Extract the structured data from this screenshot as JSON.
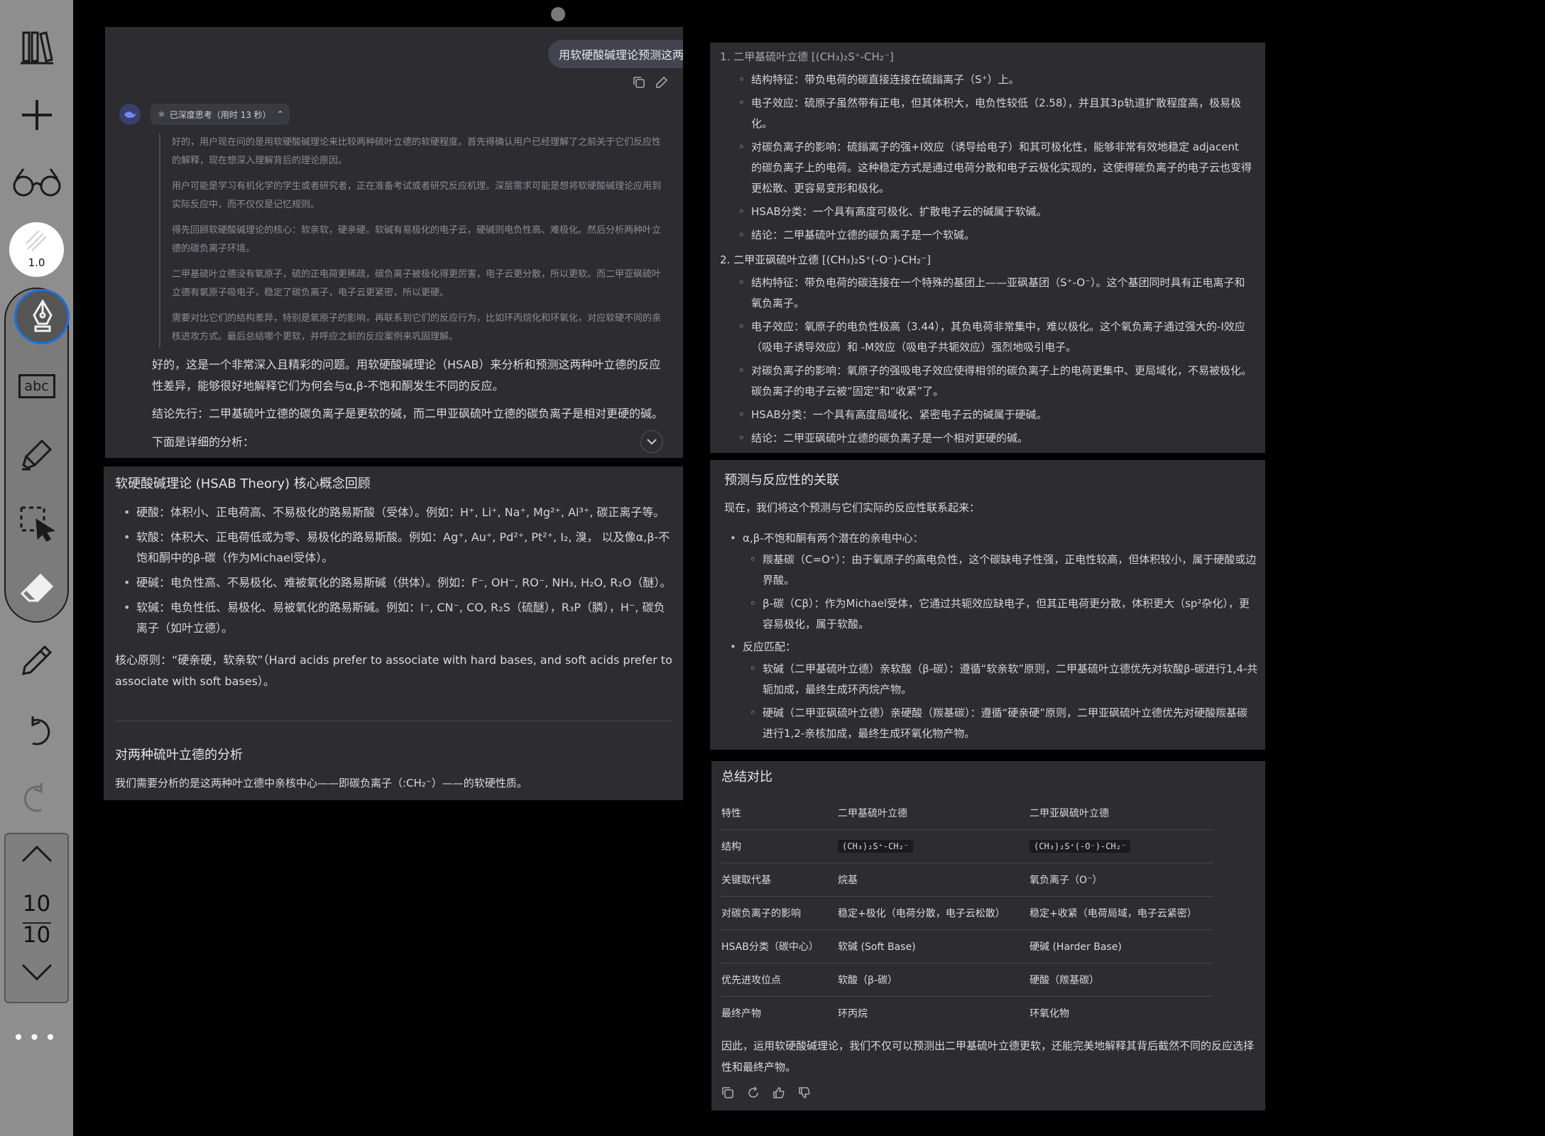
{
  "toolbar": {
    "brush_size": "1.0",
    "text_tool_label": "abc",
    "page_current": "10",
    "page_total": "10"
  },
  "chat": {
    "user_question": "用软硬酸碱理论预测这两种叶立德谁更软",
    "thinking_label": "已深度思考（用时 13 秒）",
    "thinking_paragraphs": [
      "好的，用户现在问的是用软硬酸碱理论来比较两种硫叶立德的软硬程度。首先得确认用户已经理解了之前关于它们反应性的解释，现在想深入理解背后的理论原因。",
      "用户可能是学习有机化学的学生或者研究者，正在准备考试或者研究反应机理。深层需求可能是想将软硬酸碱理论应用到实际反应中，而不仅仅是记忆规则。",
      "得先回顾软硬酸碱理论的核心：软亲软，硬亲硬。软碱有易极化的电子云，硬碱则电负性高、难极化。然后分析两种叶立德的碳负离子环境。",
      "二甲基硫叶立德没有氧原子，硫的正电荷更稀疏，碳负离子被极化得更厉害，电子云更分散，所以更软。而二甲亚砜硫叶立德有氧原子吸电子，稳定了碳负离子，电子云更紧密，所以更硬。",
      "需要对比它们的结构差异，特别是氧原子的影响，再联系到它们的反应行为，比如环丙烷化和环氧化，对应软硬不同的亲核进攻方式。最后总结哪个更软，并呼应之前的反应案例来巩固理解。"
    ],
    "answer_intro": "好的，这是一个非常深入且精彩的问题。用软硬酸碱理论（HSAB）来分析和预测这两种叶立德的反应性差异，能够很好地解释它们为何会与α,β-不饱和酮发生不同的反应。",
    "answer_conclusion": "结论先行：二甲基硫叶立德的碳负离子是更软的碱，而二甲亚砜硫叶立德的碳负离子是相对更硬的碱。",
    "answer_next": "下面是详细的分析："
  },
  "hsab": {
    "title": "软硬酸碱理论 (HSAB Theory) 核心概念回顾",
    "items": [
      "硬酸：体积小、正电荷高、不易极化的路易斯酸（受体）。例如：H⁺, Li⁺, Na⁺, Mg²⁺, Al³⁺, 碳正离子等。",
      "软酸：体积大、正电荷低或为零、易极化的路易斯酸。例如：Ag⁺, Au⁺, Pd²⁺, Pt²⁺, I₂, 溴， 以及像α,β-不饱和酮中的β-碳（作为Michael受体）。",
      "硬碱：电负性高、不易极化、难被氧化的路易斯碱（供体）。例如：F⁻, OH⁻, RO⁻, NH₃, H₂O, R₂O（醚）。",
      "软碱：电负性低、易极化、易被氧化的路易斯碱。例如：I⁻, CN⁻, CO, R₂S（硫醚），R₃P（膦），H⁻, 碳负离子（如叶立德）。"
    ],
    "principle": "核心原则：“硬亲硬，软亲软”（Hard acids prefer to associate with hard bases, and soft acids prefer to associate with soft bases）。",
    "analysis_title": "对两种硫叶立德的分析",
    "analysis_text": "我们需要分析的是这两种叶立德中亲核中心——即碳负离子（:CH₂⁻）——的软硬性质。"
  },
  "ylides": [
    {
      "heading": "二甲基硫叶立德 [(CH₃)₂S⁺-CH₂⁻]",
      "points": [
        "结构特征：带负电荷的碳直接连接在硫鎓离子（S⁺）上。",
        "电子效应：硫原子虽然带有正电，但其体积大，电负性较低（2.58），并且其3p轨道扩散程度高，极易极化。",
        "对碳负离子的影响：硫鎓离子的强+I效应（诱导给电子）和其可极化性，能够非常有效地稳定 adjacent 的碳负离子上的电荷。这种稳定方式是通过电荷分散和电子云极化实现的，这使得碳负离子的电子云也变得更松散、更容易变形和极化。",
        "HSAB分类：一个具有高度可极化、扩散电子云的碱属于软碱。",
        "结论：二甲基硫叶立德的碳负离子是一个软碱。"
      ]
    },
    {
      "heading": "二甲亚砜硫叶立德 [(CH₃)₂S⁺(-O⁻)-CH₂⁻]",
      "points": [
        "结构特征：带负电荷的碳连接在一个特殊的基团上——亚砜基团（S⁺-O⁻）。这个基团同时具有正电离子和氧负离子。",
        "电子效应：氧原子的电负性极高（3.44），其负电荷非常集中，难以极化。这个氧负离子通过强大的-I效应（吸电子诱导效应）和 -M效应（吸电子共轭效应）强烈地吸引电子。",
        "对碳负离子的影响：氧原子的强吸电子效应使得相邻的碳负离子上的电荷更集中、更局域化，不易被极化。碳负离子的电子云被“固定”和“收紧”了。",
        "HSAB分类：一个具有高度局域化、紧密电子云的碱属于硬碱。",
        "结论：二甲亚砜硫叶立德的碳负离子是一个相对更硬的碱。"
      ]
    }
  ],
  "prediction": {
    "title": "预测与反应性的关联",
    "intro": "现在，我们将这个预测与它们实际的反应性联系起来：",
    "point1": "α,β-不饱和酮有两个潜在的亲电中心：",
    "point1_sub": [
      "羰基碳（C=O⁺）：由于氧原子的高电负性，这个碳缺电子性强，正电性较高，但体积较小，属于硬酸或边界酸。",
      "β-碳（Cβ）：作为Michael受体，它通过共轭效应缺电子，但其正电荷更分散，体积更大（sp²杂化），更容易极化，属于软酸。"
    ],
    "point2": "反应匹配：",
    "point2_sub": [
      "软碱（二甲基硫叶立德）亲软酸（β-碳）：遵循“软亲软”原则，二甲基硫叶立德优先对软酸β-碳进行1,4-共轭加成，最终生成环丙烷产物。",
      "硬碱（二甲亚砜硫叶立德）亲硬酸（羰基碳）：遵循“硬亲硬”原则，二甲亚砜硫叶立德优先对硬酸羰基碳进行1,2-亲核加成，最终生成环氧化物产物。"
    ]
  },
  "summary": {
    "title": "总结对比",
    "headers": [
      "特性",
      "二甲基硫叶立德",
      "二甲亚砜硫叶立德"
    ],
    "rows": [
      [
        "结构",
        "(CH₃)₂S⁺-CH₂⁻",
        "(CH₃)₂S⁺(-O⁻)-CH₂⁻"
      ],
      [
        "关键取代基",
        "烷基",
        "氧负离子（O⁻）"
      ],
      [
        "对碳负离子的影响",
        "稳定+极化（电荷分散，电子云松散）",
        "稳定+收紧（电荷局域，电子云紧密）"
      ],
      [
        "HSAB分类（碳中心）",
        "软碱 (Soft Base)",
        "硬碱 (Harder Base)"
      ],
      [
        "优先进攻位点",
        "软酸（β-碳）",
        "硬酸（羰基碳）"
      ],
      [
        "最终产物",
        "环丙烷",
        "环氧化物"
      ]
    ],
    "closing": "因此，运用软硬酸碱理论，我们不仅可以预测出二甲基硫叶立德更软，还能完美地解释其背后截然不同的反应选择性和最终产物。"
  }
}
